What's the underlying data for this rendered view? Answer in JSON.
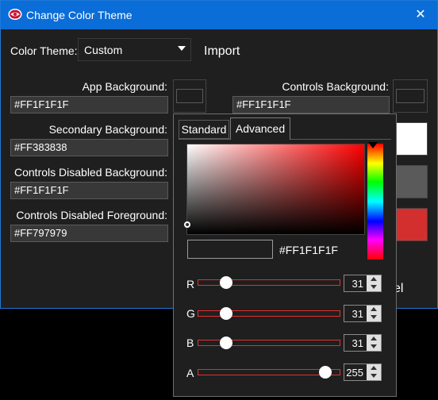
{
  "window": {
    "title": "Change Color Theme",
    "close_icon": "✕",
    "accent": "#0A6DD8",
    "background": "#1F1F1F"
  },
  "theme": {
    "label": "Color Theme:",
    "selected": "Custom",
    "import_label": "Import"
  },
  "fields": {
    "app_background": {
      "label": "App Background:",
      "value": "#FF1F1F1F",
      "swatch": "#1F1F1F"
    },
    "secondary_background": {
      "label": "Secondary Background:",
      "value": "#FF383838",
      "swatch": "#383838"
    },
    "controls_disabled_background": {
      "label": "Controls Disabled Background:",
      "value": "#FF1F1F1F",
      "swatch": "#1F1F1F"
    },
    "controls_disabled_foreground": {
      "label": "Controls Disabled Foreground:",
      "value": "#FF797979",
      "swatch": "#797979"
    },
    "controls_background": {
      "label": "Controls Background:",
      "value": "#FF1F1F1F",
      "swatch": "#1F1F1F"
    }
  },
  "right_swatches": [
    "#FFFFFF",
    "#5A5A5A",
    "#D32F2F"
  ],
  "partial_button_text": "el",
  "picker": {
    "tabs": {
      "standard": "Standard",
      "advanced": "Advanced"
    },
    "hex": "#FF1F1F1F",
    "channels": {
      "r": {
        "label": "R",
        "value": "31",
        "fraction": 0.1216
      },
      "g": {
        "label": "G",
        "value": "31",
        "fraction": 0.1216
      },
      "b": {
        "label": "B",
        "value": "31",
        "fraction": 0.1216
      },
      "a": {
        "label": "A",
        "value": "255",
        "fraction": 1.0
      }
    },
    "slider_color": "#E03030"
  }
}
